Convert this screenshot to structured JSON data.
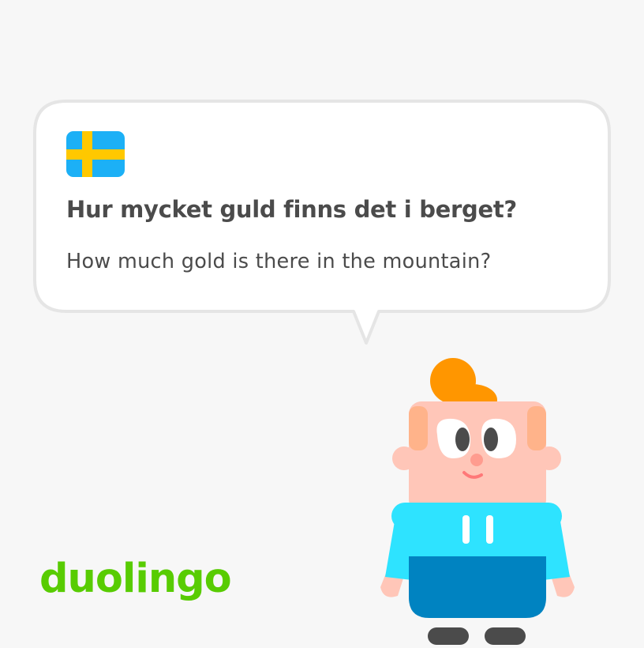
{
  "bubble": {
    "flag_icon": "sweden-flag-icon",
    "sentence": "Hur mycket guld finns det i berget?",
    "translation": "How much gold is there in the mountain?"
  },
  "brand": {
    "logo_text": "duolingo",
    "logo_color": "#58cc02"
  },
  "character": {
    "icon": "cartoon-character-icon"
  },
  "colors": {
    "background": "#f7f7f7",
    "text": "#4b4b4b",
    "bubble_border": "#e5e5e5",
    "flag_blue": "#1cb0f6",
    "flag_yellow": "#ffc800",
    "hair": "#ff9600",
    "skin": "#ffc6b8",
    "hoodie": "#2ee3ff",
    "pants": "#0083c1"
  }
}
